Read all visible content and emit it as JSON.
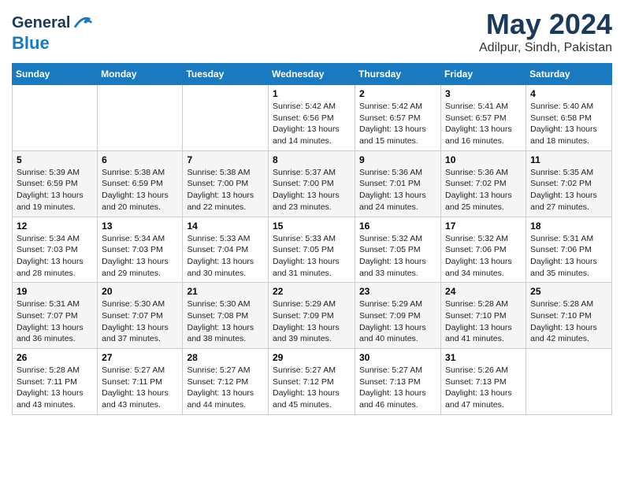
{
  "header": {
    "logo_line1": "General",
    "logo_line2": "Blue",
    "month": "May 2024",
    "location": "Adilpur, Sindh, Pakistan"
  },
  "days_of_week": [
    "Sunday",
    "Monday",
    "Tuesday",
    "Wednesday",
    "Thursday",
    "Friday",
    "Saturday"
  ],
  "weeks": [
    [
      {
        "day": "",
        "sunrise": "",
        "sunset": "",
        "daylight": ""
      },
      {
        "day": "",
        "sunrise": "",
        "sunset": "",
        "daylight": ""
      },
      {
        "day": "",
        "sunrise": "",
        "sunset": "",
        "daylight": ""
      },
      {
        "day": "1",
        "sunrise": "Sunrise: 5:42 AM",
        "sunset": "Sunset: 6:56 PM",
        "daylight": "Daylight: 13 hours and 14 minutes."
      },
      {
        "day": "2",
        "sunrise": "Sunrise: 5:42 AM",
        "sunset": "Sunset: 6:57 PM",
        "daylight": "Daylight: 13 hours and 15 minutes."
      },
      {
        "day": "3",
        "sunrise": "Sunrise: 5:41 AM",
        "sunset": "Sunset: 6:57 PM",
        "daylight": "Daylight: 13 hours and 16 minutes."
      },
      {
        "day": "4",
        "sunrise": "Sunrise: 5:40 AM",
        "sunset": "Sunset: 6:58 PM",
        "daylight": "Daylight: 13 hours and 18 minutes."
      }
    ],
    [
      {
        "day": "5",
        "sunrise": "Sunrise: 5:39 AM",
        "sunset": "Sunset: 6:59 PM",
        "daylight": "Daylight: 13 hours and 19 minutes."
      },
      {
        "day": "6",
        "sunrise": "Sunrise: 5:38 AM",
        "sunset": "Sunset: 6:59 PM",
        "daylight": "Daylight: 13 hours and 20 minutes."
      },
      {
        "day": "7",
        "sunrise": "Sunrise: 5:38 AM",
        "sunset": "Sunset: 7:00 PM",
        "daylight": "Daylight: 13 hours and 22 minutes."
      },
      {
        "day": "8",
        "sunrise": "Sunrise: 5:37 AM",
        "sunset": "Sunset: 7:00 PM",
        "daylight": "Daylight: 13 hours and 23 minutes."
      },
      {
        "day": "9",
        "sunrise": "Sunrise: 5:36 AM",
        "sunset": "Sunset: 7:01 PM",
        "daylight": "Daylight: 13 hours and 24 minutes."
      },
      {
        "day": "10",
        "sunrise": "Sunrise: 5:36 AM",
        "sunset": "Sunset: 7:02 PM",
        "daylight": "Daylight: 13 hours and 25 minutes."
      },
      {
        "day": "11",
        "sunrise": "Sunrise: 5:35 AM",
        "sunset": "Sunset: 7:02 PM",
        "daylight": "Daylight: 13 hours and 27 minutes."
      }
    ],
    [
      {
        "day": "12",
        "sunrise": "Sunrise: 5:34 AM",
        "sunset": "Sunset: 7:03 PM",
        "daylight": "Daylight: 13 hours and 28 minutes."
      },
      {
        "day": "13",
        "sunrise": "Sunrise: 5:34 AM",
        "sunset": "Sunset: 7:03 PM",
        "daylight": "Daylight: 13 hours and 29 minutes."
      },
      {
        "day": "14",
        "sunrise": "Sunrise: 5:33 AM",
        "sunset": "Sunset: 7:04 PM",
        "daylight": "Daylight: 13 hours and 30 minutes."
      },
      {
        "day": "15",
        "sunrise": "Sunrise: 5:33 AM",
        "sunset": "Sunset: 7:05 PM",
        "daylight": "Daylight: 13 hours and 31 minutes."
      },
      {
        "day": "16",
        "sunrise": "Sunrise: 5:32 AM",
        "sunset": "Sunset: 7:05 PM",
        "daylight": "Daylight: 13 hours and 33 minutes."
      },
      {
        "day": "17",
        "sunrise": "Sunrise: 5:32 AM",
        "sunset": "Sunset: 7:06 PM",
        "daylight": "Daylight: 13 hours and 34 minutes."
      },
      {
        "day": "18",
        "sunrise": "Sunrise: 5:31 AM",
        "sunset": "Sunset: 7:06 PM",
        "daylight": "Daylight: 13 hours and 35 minutes."
      }
    ],
    [
      {
        "day": "19",
        "sunrise": "Sunrise: 5:31 AM",
        "sunset": "Sunset: 7:07 PM",
        "daylight": "Daylight: 13 hours and 36 minutes."
      },
      {
        "day": "20",
        "sunrise": "Sunrise: 5:30 AM",
        "sunset": "Sunset: 7:07 PM",
        "daylight": "Daylight: 13 hours and 37 minutes."
      },
      {
        "day": "21",
        "sunrise": "Sunrise: 5:30 AM",
        "sunset": "Sunset: 7:08 PM",
        "daylight": "Daylight: 13 hours and 38 minutes."
      },
      {
        "day": "22",
        "sunrise": "Sunrise: 5:29 AM",
        "sunset": "Sunset: 7:09 PM",
        "daylight": "Daylight: 13 hours and 39 minutes."
      },
      {
        "day": "23",
        "sunrise": "Sunrise: 5:29 AM",
        "sunset": "Sunset: 7:09 PM",
        "daylight": "Daylight: 13 hours and 40 minutes."
      },
      {
        "day": "24",
        "sunrise": "Sunrise: 5:28 AM",
        "sunset": "Sunset: 7:10 PM",
        "daylight": "Daylight: 13 hours and 41 minutes."
      },
      {
        "day": "25",
        "sunrise": "Sunrise: 5:28 AM",
        "sunset": "Sunset: 7:10 PM",
        "daylight": "Daylight: 13 hours and 42 minutes."
      }
    ],
    [
      {
        "day": "26",
        "sunrise": "Sunrise: 5:28 AM",
        "sunset": "Sunset: 7:11 PM",
        "daylight": "Daylight: 13 hours and 43 minutes."
      },
      {
        "day": "27",
        "sunrise": "Sunrise: 5:27 AM",
        "sunset": "Sunset: 7:11 PM",
        "daylight": "Daylight: 13 hours and 43 minutes."
      },
      {
        "day": "28",
        "sunrise": "Sunrise: 5:27 AM",
        "sunset": "Sunset: 7:12 PM",
        "daylight": "Daylight: 13 hours and 44 minutes."
      },
      {
        "day": "29",
        "sunrise": "Sunrise: 5:27 AM",
        "sunset": "Sunset: 7:12 PM",
        "daylight": "Daylight: 13 hours and 45 minutes."
      },
      {
        "day": "30",
        "sunrise": "Sunrise: 5:27 AM",
        "sunset": "Sunset: 7:13 PM",
        "daylight": "Daylight: 13 hours and 46 minutes."
      },
      {
        "day": "31",
        "sunrise": "Sunrise: 5:26 AM",
        "sunset": "Sunset: 7:13 PM",
        "daylight": "Daylight: 13 hours and 47 minutes."
      },
      {
        "day": "",
        "sunrise": "",
        "sunset": "",
        "daylight": ""
      }
    ]
  ]
}
